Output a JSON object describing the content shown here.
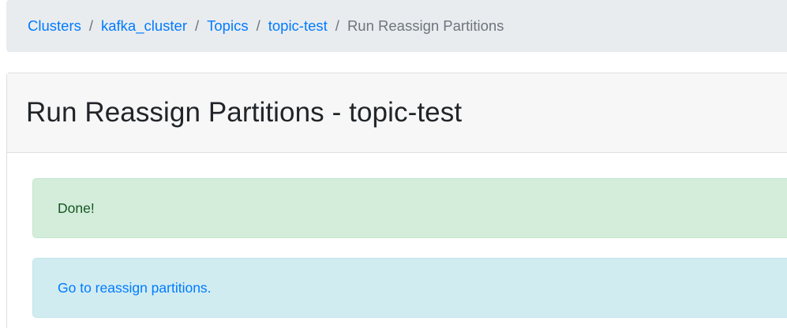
{
  "breadcrumb": {
    "items": [
      {
        "label": "Clusters"
      },
      {
        "label": "kafka_cluster"
      },
      {
        "label": "Topics"
      },
      {
        "label": "topic-test"
      }
    ],
    "separator": "/",
    "current": "Run Reassign Partitions"
  },
  "card": {
    "title": "Run Reassign Partitions - topic-test"
  },
  "alerts": {
    "success_message": "Done!",
    "info_link": "Go to reassign partitions."
  },
  "colors": {
    "link": "#007bff",
    "breadcrumb_bg": "#e9ecef",
    "success_bg": "#d4edda",
    "success_text": "#155724",
    "info_bg": "#d1ecf1"
  }
}
